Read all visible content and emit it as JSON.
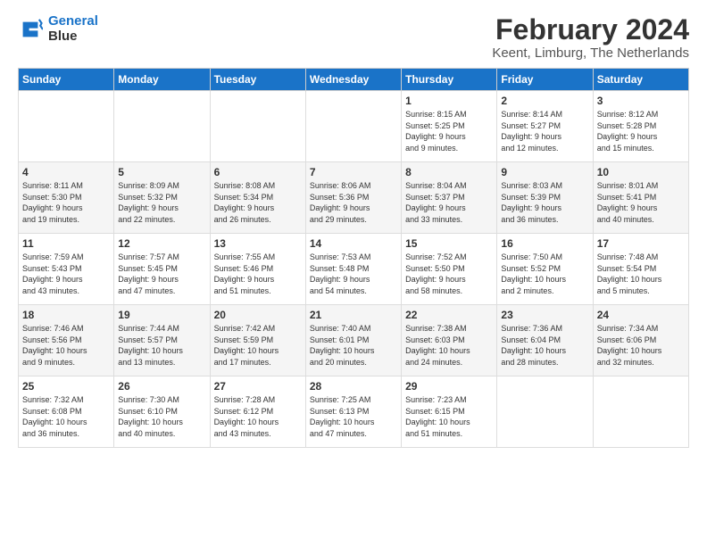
{
  "logo": {
    "line1": "General",
    "line2": "Blue"
  },
  "title": "February 2024",
  "location": "Keent, Limburg, The Netherlands",
  "weekdays": [
    "Sunday",
    "Monday",
    "Tuesday",
    "Wednesday",
    "Thursday",
    "Friday",
    "Saturday"
  ],
  "weeks": [
    [
      {
        "day": "",
        "info": ""
      },
      {
        "day": "",
        "info": ""
      },
      {
        "day": "",
        "info": ""
      },
      {
        "day": "",
        "info": ""
      },
      {
        "day": "1",
        "info": "Sunrise: 8:15 AM\nSunset: 5:25 PM\nDaylight: 9 hours\nand 9 minutes."
      },
      {
        "day": "2",
        "info": "Sunrise: 8:14 AM\nSunset: 5:27 PM\nDaylight: 9 hours\nand 12 minutes."
      },
      {
        "day": "3",
        "info": "Sunrise: 8:12 AM\nSunset: 5:28 PM\nDaylight: 9 hours\nand 15 minutes."
      }
    ],
    [
      {
        "day": "4",
        "info": "Sunrise: 8:11 AM\nSunset: 5:30 PM\nDaylight: 9 hours\nand 19 minutes."
      },
      {
        "day": "5",
        "info": "Sunrise: 8:09 AM\nSunset: 5:32 PM\nDaylight: 9 hours\nand 22 minutes."
      },
      {
        "day": "6",
        "info": "Sunrise: 8:08 AM\nSunset: 5:34 PM\nDaylight: 9 hours\nand 26 minutes."
      },
      {
        "day": "7",
        "info": "Sunrise: 8:06 AM\nSunset: 5:36 PM\nDaylight: 9 hours\nand 29 minutes."
      },
      {
        "day": "8",
        "info": "Sunrise: 8:04 AM\nSunset: 5:37 PM\nDaylight: 9 hours\nand 33 minutes."
      },
      {
        "day": "9",
        "info": "Sunrise: 8:03 AM\nSunset: 5:39 PM\nDaylight: 9 hours\nand 36 minutes."
      },
      {
        "day": "10",
        "info": "Sunrise: 8:01 AM\nSunset: 5:41 PM\nDaylight: 9 hours\nand 40 minutes."
      }
    ],
    [
      {
        "day": "11",
        "info": "Sunrise: 7:59 AM\nSunset: 5:43 PM\nDaylight: 9 hours\nand 43 minutes."
      },
      {
        "day": "12",
        "info": "Sunrise: 7:57 AM\nSunset: 5:45 PM\nDaylight: 9 hours\nand 47 minutes."
      },
      {
        "day": "13",
        "info": "Sunrise: 7:55 AM\nSunset: 5:46 PM\nDaylight: 9 hours\nand 51 minutes."
      },
      {
        "day": "14",
        "info": "Sunrise: 7:53 AM\nSunset: 5:48 PM\nDaylight: 9 hours\nand 54 minutes."
      },
      {
        "day": "15",
        "info": "Sunrise: 7:52 AM\nSunset: 5:50 PM\nDaylight: 9 hours\nand 58 minutes."
      },
      {
        "day": "16",
        "info": "Sunrise: 7:50 AM\nSunset: 5:52 PM\nDaylight: 10 hours\nand 2 minutes."
      },
      {
        "day": "17",
        "info": "Sunrise: 7:48 AM\nSunset: 5:54 PM\nDaylight: 10 hours\nand 5 minutes."
      }
    ],
    [
      {
        "day": "18",
        "info": "Sunrise: 7:46 AM\nSunset: 5:56 PM\nDaylight: 10 hours\nand 9 minutes."
      },
      {
        "day": "19",
        "info": "Sunrise: 7:44 AM\nSunset: 5:57 PM\nDaylight: 10 hours\nand 13 minutes."
      },
      {
        "day": "20",
        "info": "Sunrise: 7:42 AM\nSunset: 5:59 PM\nDaylight: 10 hours\nand 17 minutes."
      },
      {
        "day": "21",
        "info": "Sunrise: 7:40 AM\nSunset: 6:01 PM\nDaylight: 10 hours\nand 20 minutes."
      },
      {
        "day": "22",
        "info": "Sunrise: 7:38 AM\nSunset: 6:03 PM\nDaylight: 10 hours\nand 24 minutes."
      },
      {
        "day": "23",
        "info": "Sunrise: 7:36 AM\nSunset: 6:04 PM\nDaylight: 10 hours\nand 28 minutes."
      },
      {
        "day": "24",
        "info": "Sunrise: 7:34 AM\nSunset: 6:06 PM\nDaylight: 10 hours\nand 32 minutes."
      }
    ],
    [
      {
        "day": "25",
        "info": "Sunrise: 7:32 AM\nSunset: 6:08 PM\nDaylight: 10 hours\nand 36 minutes."
      },
      {
        "day": "26",
        "info": "Sunrise: 7:30 AM\nSunset: 6:10 PM\nDaylight: 10 hours\nand 40 minutes."
      },
      {
        "day": "27",
        "info": "Sunrise: 7:28 AM\nSunset: 6:12 PM\nDaylight: 10 hours\nand 43 minutes."
      },
      {
        "day": "28",
        "info": "Sunrise: 7:25 AM\nSunset: 6:13 PM\nDaylight: 10 hours\nand 47 minutes."
      },
      {
        "day": "29",
        "info": "Sunrise: 7:23 AM\nSunset: 6:15 PM\nDaylight: 10 hours\nand 51 minutes."
      },
      {
        "day": "",
        "info": ""
      },
      {
        "day": "",
        "info": ""
      }
    ]
  ]
}
